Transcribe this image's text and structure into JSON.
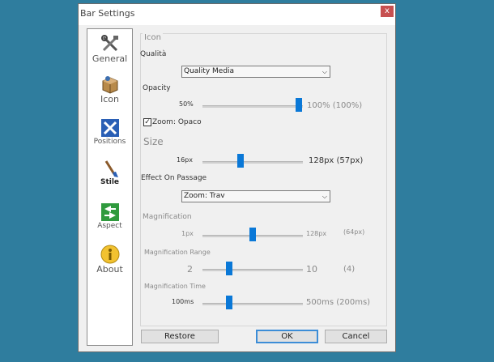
{
  "window": {
    "title": "Bar Settings",
    "close_glyph": "x"
  },
  "sidebar": {
    "items": [
      {
        "label": "General",
        "icon": "tools-icon"
      },
      {
        "label": "Icon",
        "icon": "box-icon"
      },
      {
        "label": "Positions",
        "icon": "arrows-icon"
      },
      {
        "label": "Stile",
        "icon": "brush-icon"
      },
      {
        "label": "Aspect",
        "icon": "swap-icon"
      },
      {
        "label": "About",
        "icon": "info-icon"
      }
    ]
  },
  "panel": {
    "group_title": "Icon",
    "quality": {
      "label": "Qualità",
      "value": "Quality Media"
    },
    "opacity": {
      "label": "Opacity",
      "min": "50%",
      "value": "100% (100%)",
      "level": 1.0
    },
    "zoom_opaque": {
      "label": "Zoom: Opaco",
      "checked": "✓"
    },
    "size": {
      "label": "Size",
      "min": "16px",
      "value": "128px (57px)",
      "level": 0.35
    },
    "effect": {
      "label": "Effect On Passage",
      "value": "Zoom: Trav"
    },
    "magnification": {
      "label": "Magnification",
      "min": "1px",
      "max": "128px",
      "value": "(64px)",
      "level": 0.5
    },
    "magnification_range": {
      "label": "Magnification Range",
      "min": "2",
      "max": "10",
      "value": "(4)",
      "level": 0.25
    },
    "magnification_time": {
      "label": "Magnification Time",
      "min": "100ms",
      "value": "500ms (200ms)",
      "level": 0.25
    }
  },
  "footer": {
    "restore": "Restore",
    "ok": "OK",
    "cancel": "Cancel"
  }
}
